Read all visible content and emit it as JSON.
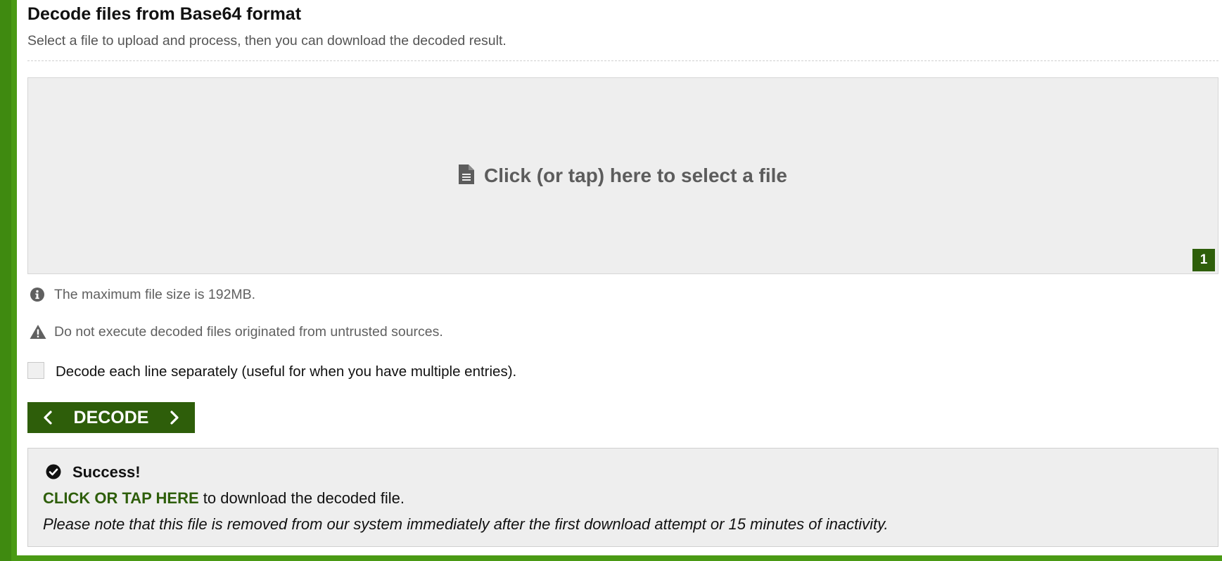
{
  "colors": {
    "brand_green": "#2e5e0a",
    "page_border_green": "#4a9a14",
    "panel_gray": "#eeeeee"
  },
  "header": {
    "title": "Decode files from Base64 format",
    "subtitle": "Select a file to upload and process, then you can download the decoded result."
  },
  "upload": {
    "icon": "file-icon",
    "label": "Click (or tap) here to select a file",
    "count_badge": "1"
  },
  "notes": {
    "max_size": {
      "icon": "info-icon",
      "text": "The maximum file size is 192MB."
    },
    "warning": {
      "icon": "warning-icon",
      "text": "Do not execute decoded files originated from untrusted sources."
    }
  },
  "options": {
    "line_by_line": {
      "label": "Decode each line separately (useful for when you have multiple entries).",
      "checked": false
    }
  },
  "action": {
    "decode_label": "DECODE",
    "left_icon": "chevron-left-icon",
    "right_icon": "chevron-right-icon"
  },
  "result": {
    "icon": "check-circle-icon",
    "title": "Success!",
    "link_label": "CLICK OR TAP HERE",
    "link_suffix": " to download the decoded file.",
    "notice": "Please note that this file is removed from our system immediately after the first download attempt or 15 minutes of inactivity."
  }
}
